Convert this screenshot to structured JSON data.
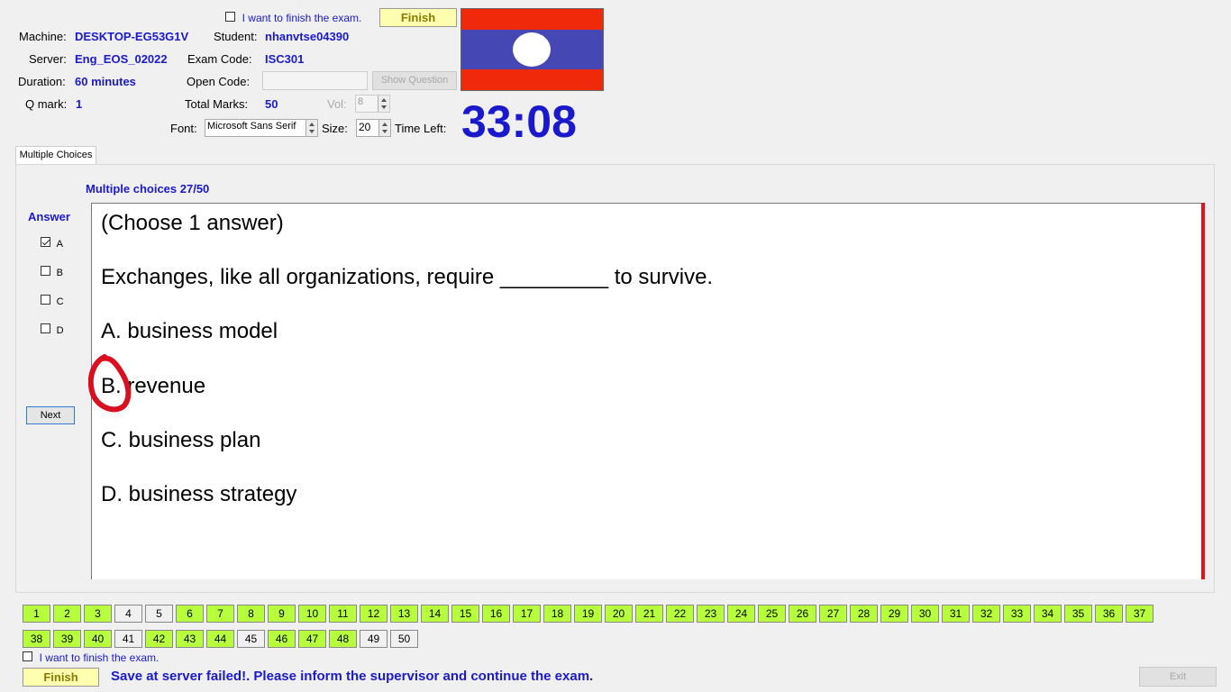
{
  "header": {
    "finish_checkbox_label": "I want to finish the exam.",
    "finish_button": "Finish",
    "machine_label": "Machine:",
    "machine_value": "DESKTOP-EG53G1V",
    "student_label": "Student:",
    "student_value": "nhanvtse04390",
    "server_label": "Server:",
    "server_value": "Eng_EOS_02022",
    "exam_code_label": "Exam Code:",
    "exam_code_value": "ISC301",
    "duration_label": "Duration:",
    "duration_value": "60 minutes",
    "open_code_label": "Open Code:",
    "open_code_value": "",
    "show_question_button": "Show Question",
    "qmark_label": "Q mark:",
    "qmark_value": "1",
    "total_marks_label": "Total Marks:",
    "total_marks_value": "50",
    "vol_label": "Vol:",
    "vol_value": "8",
    "font_label": "Font:",
    "font_value": "Microsoft Sans Serif",
    "size_label": "Size:",
    "size_value": "20",
    "time_left_label": "Time Left:",
    "timer": "33:08"
  },
  "colors": {
    "flag_red": "#f0290b",
    "flag_blue": "#4547b5",
    "accent_blue": "#1a1acc",
    "done_green": "#b7ff3c",
    "annotation_red": "#d81020"
  },
  "tab": {
    "label": "Multiple Choices"
  },
  "question": {
    "progress": "Multiple choices 27/50",
    "answer_label": "Answer",
    "options": [
      {
        "key": "A",
        "checked": true
      },
      {
        "key": "B",
        "checked": false
      },
      {
        "key": "C",
        "checked": false
      },
      {
        "key": "D",
        "checked": false
      }
    ],
    "next_button": "Next",
    "lines": [
      "(Choose 1 answer)",
      "Exchanges, like all organizations, require _________ to survive.",
      "A.  business model",
      "B.  revenue",
      "C.  business plan",
      "D.  business strategy"
    ]
  },
  "question_grid": {
    "row1": [
      {
        "n": "1",
        "done": true
      },
      {
        "n": "2",
        "done": true
      },
      {
        "n": "3",
        "done": true
      },
      {
        "n": "4",
        "done": false
      },
      {
        "n": "5",
        "done": false
      },
      {
        "n": "6",
        "done": true
      },
      {
        "n": "7",
        "done": true
      },
      {
        "n": "8",
        "done": true
      },
      {
        "n": "9",
        "done": true
      },
      {
        "n": "10",
        "done": true
      },
      {
        "n": "11",
        "done": true
      },
      {
        "n": "12",
        "done": true
      },
      {
        "n": "13",
        "done": true
      },
      {
        "n": "14",
        "done": true
      },
      {
        "n": "15",
        "done": true
      },
      {
        "n": "16",
        "done": true
      },
      {
        "n": "17",
        "done": true
      },
      {
        "n": "18",
        "done": true
      },
      {
        "n": "19",
        "done": true
      },
      {
        "n": "20",
        "done": true
      },
      {
        "n": "21",
        "done": true
      },
      {
        "n": "22",
        "done": true
      },
      {
        "n": "23",
        "done": true
      },
      {
        "n": "24",
        "done": true
      },
      {
        "n": "25",
        "done": true
      },
      {
        "n": "26",
        "done": true
      },
      {
        "n": "27",
        "done": true
      },
      {
        "n": "28",
        "done": true
      },
      {
        "n": "29",
        "done": true
      },
      {
        "n": "30",
        "done": true
      },
      {
        "n": "31",
        "done": true
      },
      {
        "n": "32",
        "done": true
      },
      {
        "n": "33",
        "done": true
      },
      {
        "n": "34",
        "done": true
      },
      {
        "n": "35",
        "done": true
      },
      {
        "n": "36",
        "done": true
      },
      {
        "n": "37",
        "done": true
      }
    ],
    "row2": [
      {
        "n": "38",
        "done": true
      },
      {
        "n": "39",
        "done": true
      },
      {
        "n": "40",
        "done": true
      },
      {
        "n": "41",
        "done": false
      },
      {
        "n": "42",
        "done": true
      },
      {
        "n": "43",
        "done": true
      },
      {
        "n": "44",
        "done": true
      },
      {
        "n": "45",
        "done": false
      },
      {
        "n": "46",
        "done": true
      },
      {
        "n": "47",
        "done": true
      },
      {
        "n": "48",
        "done": true
      },
      {
        "n": "49",
        "done": false
      },
      {
        "n": "50",
        "done": false
      }
    ]
  },
  "footer": {
    "finish_checkbox_label": "I want to finish the exam.",
    "finish_button": "Finish",
    "status_message": "Save at server failed!. Please inform the supervisor and continue the exam.",
    "exit_button": "Exit"
  }
}
